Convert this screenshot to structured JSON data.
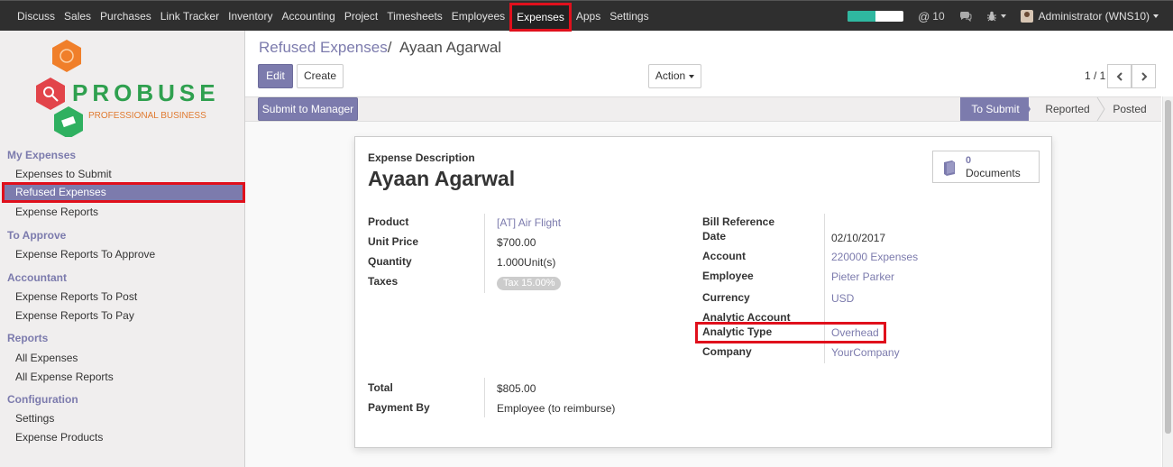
{
  "topnav": {
    "menu": [
      "Discuss",
      "Sales",
      "Purchases",
      "Link Tracker",
      "Inventory",
      "Accounting",
      "Project",
      "Timesheets",
      "Employees",
      "Expenses",
      "Apps",
      "Settings"
    ],
    "active": "Expenses",
    "progress_fraction": 0.5,
    "mentions_count": "10",
    "user": "Administrator (WNS10)"
  },
  "logo": {
    "name": "PROBUSE",
    "tagline": "PROFESSIONAL BUSINESS"
  },
  "sidebar": {
    "sections": [
      {
        "title": "My Expenses",
        "items": [
          "Expenses to Submit",
          "Refused Expenses",
          "Expense Reports"
        ]
      },
      {
        "title": "To Approve",
        "items": [
          "Expense Reports To Approve"
        ]
      },
      {
        "title": "Accountant",
        "items": [
          "Expense Reports To Post",
          "Expense Reports To Pay"
        ]
      },
      {
        "title": "Reports",
        "items": [
          "All Expenses",
          "All Expense Reports"
        ]
      },
      {
        "title": "Configuration",
        "items": [
          "Settings",
          "Expense Products"
        ]
      }
    ],
    "selected": "Refused Expenses"
  },
  "breadcrumb": {
    "parent": "Refused Expenses",
    "separator": "/",
    "current": "Ayaan Agarwal"
  },
  "buttons": {
    "edit": "Edit",
    "create": "Create",
    "action": "Action",
    "submit_manager": "Submit to Manager"
  },
  "pager": {
    "text": "1 / 1"
  },
  "stages": [
    "To Submit",
    "Reported",
    "Posted"
  ],
  "current_stage": "To Submit",
  "form": {
    "description_label": "Expense Description",
    "title": "Ayaan Agarwal",
    "documents": {
      "count": "0",
      "label": "Documents"
    },
    "left": [
      {
        "label": "Product",
        "value": "[AT] Air Flight",
        "link": true
      },
      {
        "label": "Unit Price",
        "value": "$700.00"
      },
      {
        "label": "Quantity",
        "value": "1.000Unit(s)"
      },
      {
        "label": "Taxes",
        "value": "Tax 15.00%",
        "tag": true
      }
    ],
    "right": [
      {
        "label": "Bill Reference",
        "value": ""
      },
      {
        "label": "Date",
        "value": "02/10/2017"
      },
      {
        "label": "Account",
        "value": "220000 Expenses",
        "link": true
      },
      {
        "label": "Employee",
        "value": "Pieter Parker",
        "link": true
      },
      {
        "label": "Currency",
        "value": "USD",
        "link": true
      },
      {
        "label": "Analytic Account",
        "value": ""
      },
      {
        "label": "Analytic Type",
        "value": "Overhead",
        "link": true
      },
      {
        "label": "Company",
        "value": "YourCompany",
        "link": true
      }
    ],
    "bottom": [
      {
        "label": "Total",
        "value": "$805.00"
      },
      {
        "label": "Payment By",
        "value": "Employee (to reimburse)"
      }
    ]
  },
  "colors": {
    "brand": "#7c7bad",
    "highlight": "#e0101c",
    "navbar": "#2f2f2f",
    "progress": "#2fb8a0"
  }
}
